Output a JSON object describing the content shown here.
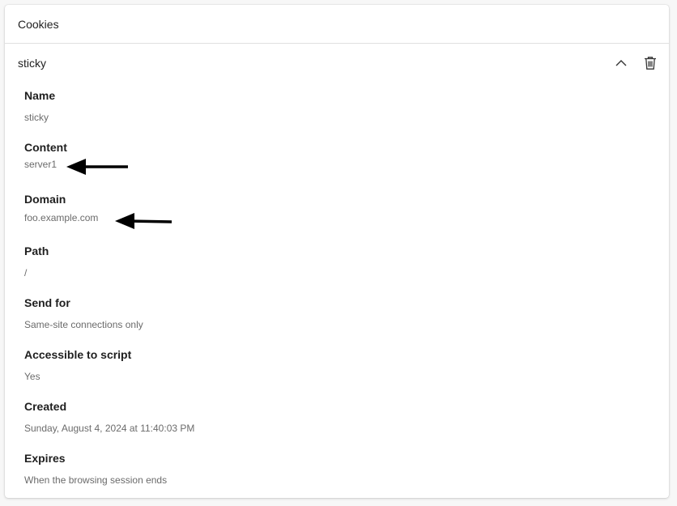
{
  "header": {
    "title": "Cookies"
  },
  "cookie": {
    "name": "sticky",
    "collapse_icon": "chevron-up-icon",
    "delete_icon": "trash-icon"
  },
  "fields": [
    {
      "label": "Name",
      "value": "sticky"
    },
    {
      "label": "Content",
      "value": "server1"
    },
    {
      "label": "Domain",
      "value": "foo.example.com"
    },
    {
      "label": "Path",
      "value": "/"
    },
    {
      "label": "Send for",
      "value": "Same-site connections only"
    },
    {
      "label": "Accessible to script",
      "value": "Yes"
    },
    {
      "label": "Created",
      "value": "Sunday, August 4, 2024 at 11:40:03 PM"
    },
    {
      "label": "Expires",
      "value": "When the browsing session ends"
    }
  ],
  "annotations": {
    "arrow_color": "#000000"
  }
}
